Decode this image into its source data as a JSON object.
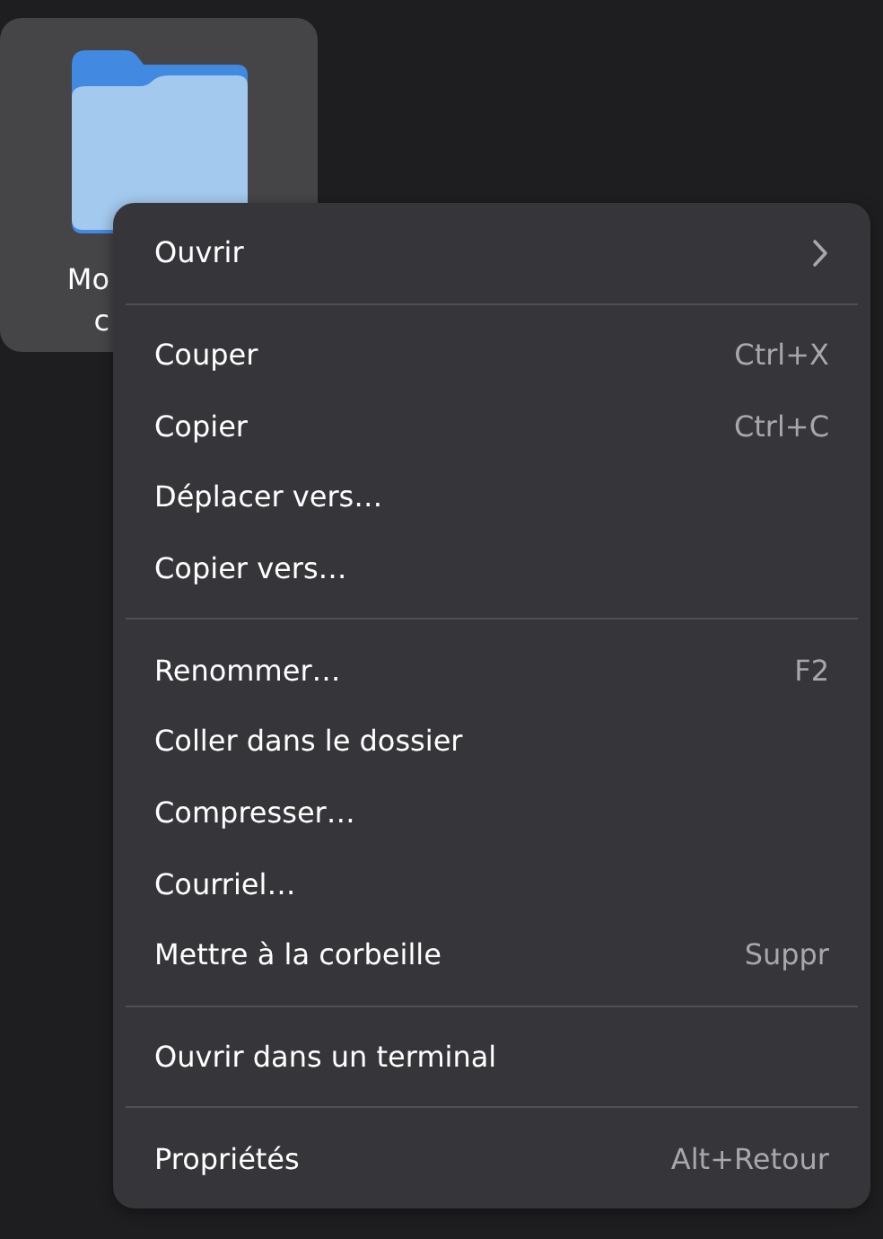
{
  "folder": {
    "label_lines": [
      "Mo",
      "c"
    ],
    "selected": true
  },
  "context_menu": {
    "sections": [
      {
        "items": [
          {
            "kind": "submenu",
            "label": "Ouvrir"
          }
        ]
      },
      {
        "items": [
          {
            "kind": "item",
            "label": "Couper",
            "shortcut": "Ctrl+X"
          },
          {
            "kind": "item",
            "label": "Copier",
            "shortcut": "Ctrl+C"
          },
          {
            "kind": "item",
            "label": "Déplacer vers…"
          },
          {
            "kind": "item",
            "label": "Copier vers…"
          }
        ]
      },
      {
        "items": [
          {
            "kind": "item",
            "label": "Renommer…",
            "shortcut": "F2"
          },
          {
            "kind": "item",
            "label": "Coller dans le dossier"
          },
          {
            "kind": "item",
            "label": "Compresser…"
          },
          {
            "kind": "item",
            "label": "Courriel…"
          },
          {
            "kind": "item",
            "label": "Mettre à la corbeille",
            "shortcut": "Suppr"
          }
        ]
      },
      {
        "items": [
          {
            "kind": "item",
            "label": "Ouvrir dans un terminal"
          }
        ]
      },
      {
        "items": [
          {
            "kind": "item",
            "label": "Propriétés",
            "shortcut": "Alt+Retour"
          }
        ]
      }
    ]
  }
}
